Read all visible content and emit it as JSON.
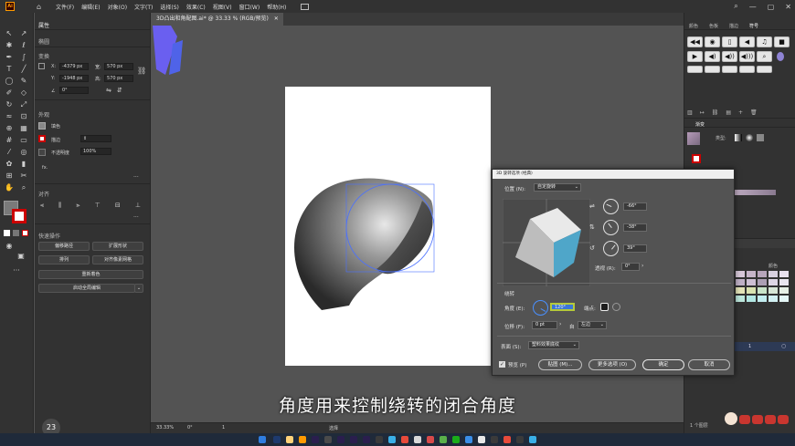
{
  "app": {
    "logo": "Ai"
  },
  "menu": [
    "文件(F)",
    "编辑(E)",
    "对象(O)",
    "文字(T)",
    "选择(S)",
    "效果(C)",
    "视图(V)",
    "窗口(W)",
    "帮助(H)"
  ],
  "document_tab": {
    "title": "3D凸出和角配图.ai* @ 33.33 % (RGB/预览)"
  },
  "properties": {
    "tab_label": "属性",
    "object_type": "椭圆",
    "transform_label": "变换",
    "x_label": "X:",
    "x_value": "-4379 px",
    "y_label": "Y:",
    "y_value": "-1948 px",
    "w_label": "宽:",
    "w_value": "570 px",
    "h_label": "高:",
    "h_value": "570 px",
    "angle_value": "0°",
    "appearance_label": "外观",
    "fill_label": "填色",
    "stroke_label": "描边",
    "opacity_label": "不透明度",
    "opacity_value": "100%",
    "fx_label": "fx.",
    "align_label": "对齐",
    "quick_actions_label": "快速操作",
    "btn_offset_path": "偏移路径",
    "btn_expand_shape": "扩展形状",
    "btn_arrange": "排列",
    "btn_align_pixel": "对齐像素网格",
    "btn_recolor": "重新着色",
    "btn_global_edit": "启动全局编辑"
  },
  "right_panel": {
    "tabs": [
      "颜色",
      "色板",
      "描边",
      "符号"
    ],
    "gradient_label": "渐变",
    "gradient_type_label": "类型:",
    "layers_count": "1 个图层",
    "layer_name": "1",
    "swatches_label": "颜色"
  },
  "dialog": {
    "title": "3D 旋转选项 (经典)",
    "position_label": "位置 (N):",
    "position_value": "自定旋转",
    "rot_x": "-66°",
    "rot_y": "-38°",
    "rot_z": "39°",
    "perspective_label": "透视 (R):",
    "perspective_value": "0°",
    "revolve_label": "绕转",
    "angle_label": "角度 (E):",
    "angle_value": "120°",
    "cap_label": "端点:",
    "offset_label": "位移 (F):",
    "offset_value": "0 pt",
    "from_label": "自",
    "from_value": "左边",
    "surface_label": "表面 (S):",
    "surface_value": "塑料效果底纹",
    "preview_label": "预览 (P)",
    "btn_map": "贴图 (M)...",
    "btn_more": "更多选项 (O)",
    "btn_ok": "确定",
    "btn_cancel": "取消"
  },
  "status": {
    "zoom": "33.33%",
    "angle": "0°",
    "page": "1",
    "tool": "选择"
  },
  "subtitle": "角度用来控制绕转的闭合角度",
  "timer": "23",
  "colors": {
    "accent": "#4a90ff",
    "panel_bg": "#323232",
    "canvas_bg": "#535353"
  }
}
